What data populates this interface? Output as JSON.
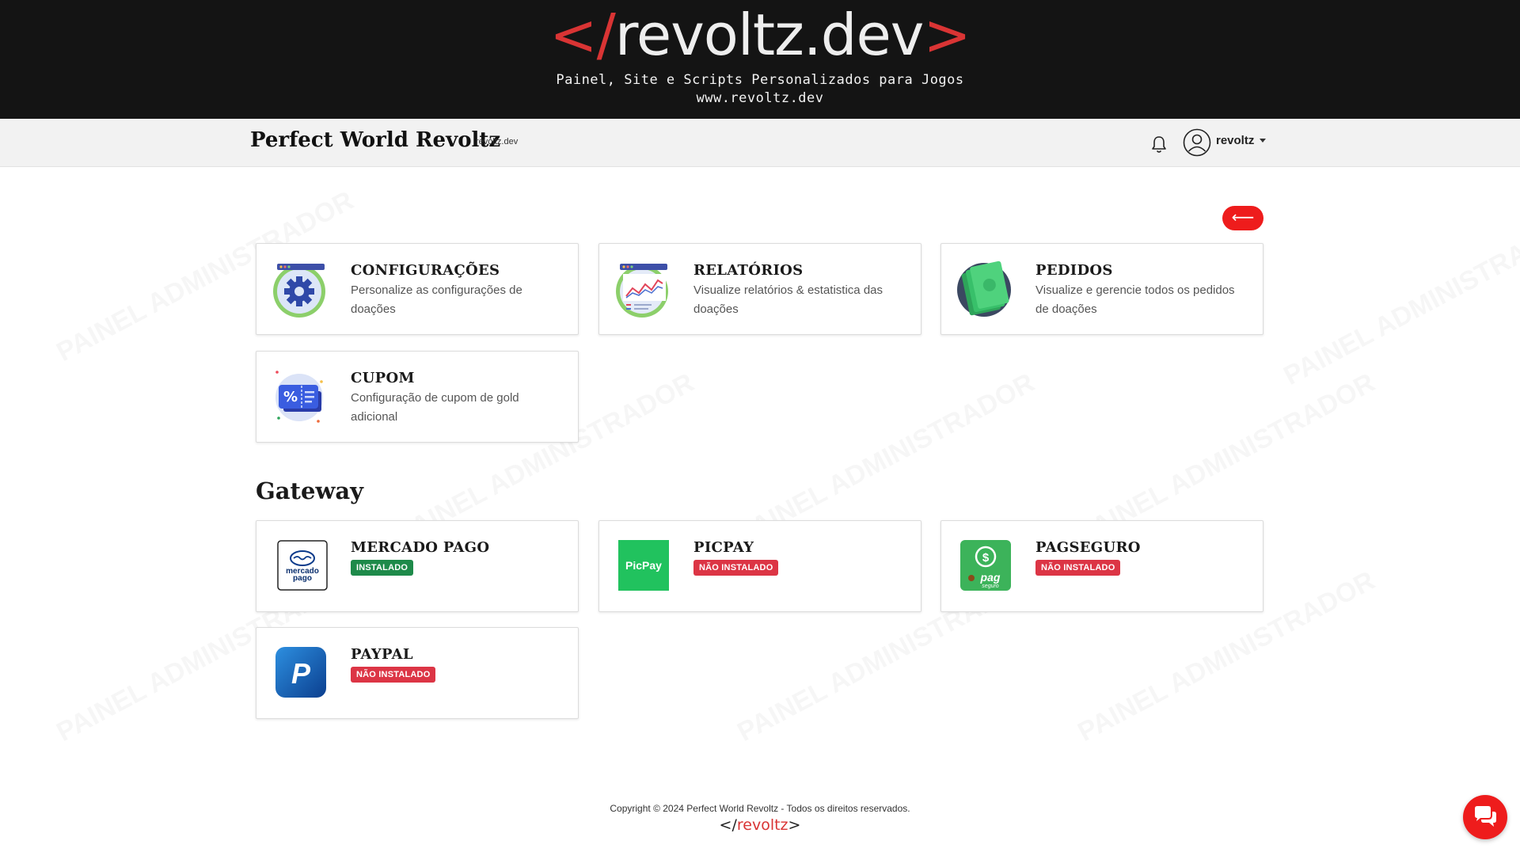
{
  "banner": {
    "logo_lt": "</",
    "logo_text": "revoltz.dev",
    "logo_gt": ">",
    "tagline_line1": "Painel, Site e Scripts Personalizados para Jogos",
    "tagline_line2": "www.revoltz.dev"
  },
  "navbar": {
    "brand": "Perfect World Revoltz",
    "brand_sub": "revoltz.dev",
    "user_name": "revoltz",
    "icons": [
      "bell-icon",
      "user-avatar-icon",
      "caret-down-icon"
    ]
  },
  "back_button": {
    "label": "⟵"
  },
  "watermark": {
    "text": "PAINEL ADMINISTRADOR"
  },
  "cards": [
    {
      "title": "CONFIGURAÇÕES",
      "description": "Personalize as configurações de doações",
      "icon": "settings-gear-icon"
    },
    {
      "title": "RELATÓRIOS",
      "description": "Visualize relatórios & estatistica das doações",
      "icon": "report-chart-icon"
    },
    {
      "title": "PEDIDOS",
      "description": "Visualize e gerencie todos os pedidos de doações",
      "icon": "money-bills-icon"
    },
    {
      "title": "CUPOM",
      "description": "Configuração de cupom de gold adicional",
      "icon": "coupon-icon"
    }
  ],
  "gateway": {
    "section_title": "Gateway",
    "items": [
      {
        "title": "MERCADO PAGO",
        "status": "INSTALADO",
        "icon": "mercado-pago-logo",
        "logo_text_1": "mercado",
        "logo_text_2": "pago"
      },
      {
        "title": "PICPAY",
        "status": "NÃO INSTALADO",
        "icon": "picpay-logo",
        "logo_text_1": "PicPay"
      },
      {
        "title": "PAGSEGURO",
        "status": "NÃO INSTALADO",
        "icon": "pagseguro-logo",
        "logo_text_1": "pag",
        "logo_text_2": "seguro"
      },
      {
        "title": "PAYPAL",
        "status": "NÃO INSTALADO",
        "icon": "paypal-logo",
        "logo_text_1": "P"
      }
    ]
  },
  "footer": {
    "copyright": "Copyright © 2024 Perfect World Revoltz - Todos os direitos reservados.",
    "logo_lt": "</",
    "logo_text": "revoltz",
    "logo_gt": ">"
  },
  "chat": {
    "icon": "chat-bubbles-icon"
  },
  "colors": {
    "accent_red": "#ee1c1c",
    "installed_green": "#1e8a4a",
    "not_installed_red": "#dc3545",
    "banner_bg": "#141414",
    "navbar_bg": "#f2f2f2"
  }
}
